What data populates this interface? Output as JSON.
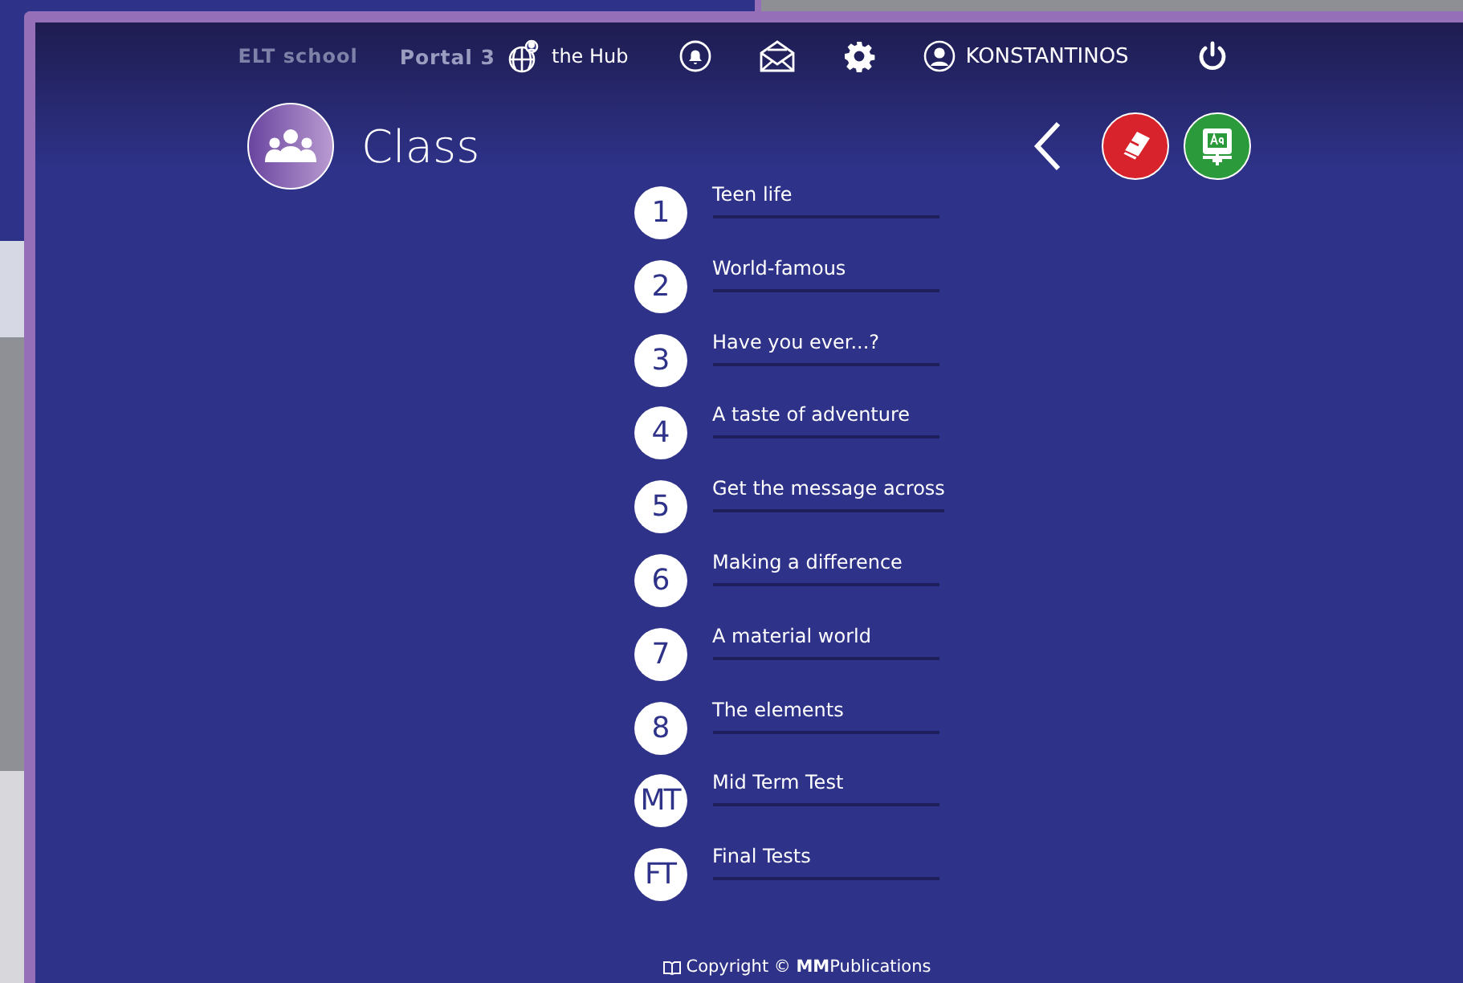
{
  "top_nav": {
    "school": "ELT school",
    "product": "Portal 3",
    "hub": "the Hub",
    "user": "KONSTANTINOS"
  },
  "page": {
    "title": "Class"
  },
  "units": [
    {
      "number": "1",
      "title": "Teen life"
    },
    {
      "number": "2",
      "title": "World-famous"
    },
    {
      "number": "3",
      "title": "Have you ever...?"
    },
    {
      "number": "4",
      "title": "A taste of adventure"
    },
    {
      "number": "5",
      "title": "Get the message across"
    },
    {
      "number": "6",
      "title": "Making a difference"
    },
    {
      "number": "7",
      "title": "A material world"
    },
    {
      "number": "8",
      "title": "The elements"
    },
    {
      "number": "MT",
      "title": "Mid Term Test"
    },
    {
      "number": "FT",
      "title": "Final Tests"
    }
  ],
  "footer": {
    "copyright": "Copyright © **MM**Publications"
  }
}
